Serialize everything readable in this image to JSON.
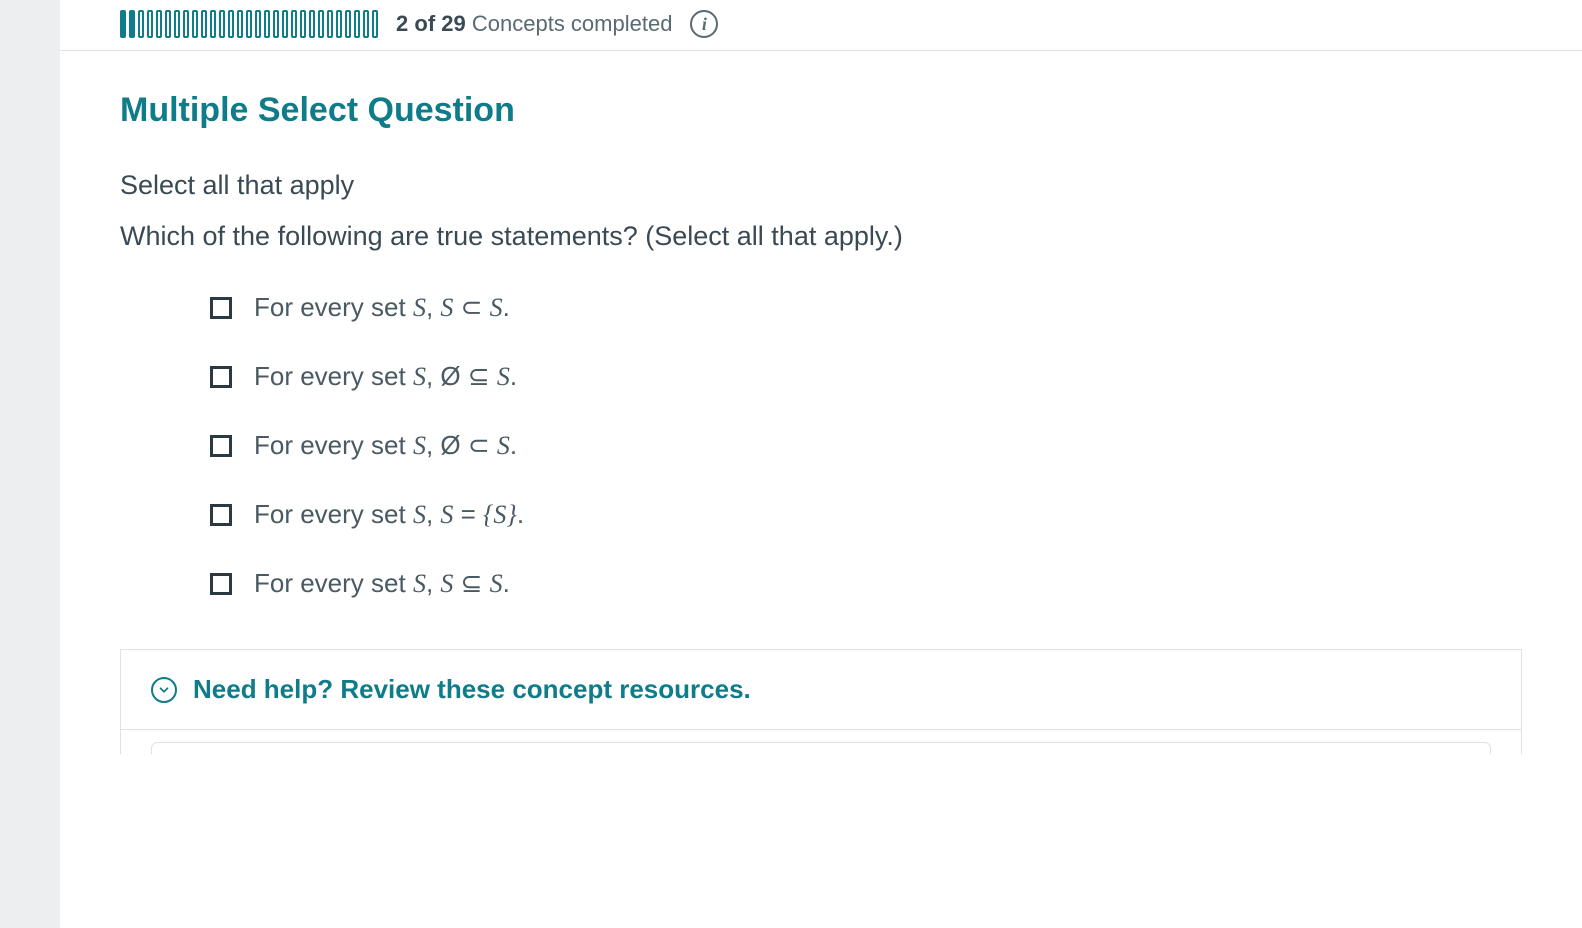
{
  "progress": {
    "completed_segments": 2,
    "total_segments": 29,
    "done": "2",
    "of_word": "of",
    "total": "29",
    "label_tail": "Concepts completed",
    "info_glyph": "i"
  },
  "question": {
    "type_label": "Multiple Select Question",
    "instructions": "Select all that apply",
    "prompt": "Which of the following are true statements? (Select all that apply.)"
  },
  "options": [
    {
      "prefix": "For every set ",
      "s1": "S",
      "mid": ", ",
      "s2": "S",
      "rel": " ⊂ ",
      "s3": "S",
      "tail": "."
    },
    {
      "prefix": "For every set ",
      "s1": "S",
      "mid": ", ",
      "s2": "Ø",
      "rel": " ⊆ ",
      "s3": "S",
      "tail": "."
    },
    {
      "prefix": "For every set ",
      "s1": "S",
      "mid": ", ",
      "s2": "Ø",
      "rel": " ⊂ ",
      "s3": "S",
      "tail": "."
    },
    {
      "prefix": "For every set ",
      "s1": "S",
      "mid": ", ",
      "s2": "S",
      "rel": " = ",
      "s3": "{S}",
      "tail": "."
    },
    {
      "prefix": "For every set ",
      "s1": "S",
      "mid": ", ",
      "s2": "S",
      "rel": " ⊆ ",
      "s3": "S",
      "tail": "."
    }
  ],
  "help": {
    "label": "Need help? Review these concept resources."
  },
  "colors": {
    "accent": "#0f7c8a",
    "text": "#3a4a54"
  }
}
